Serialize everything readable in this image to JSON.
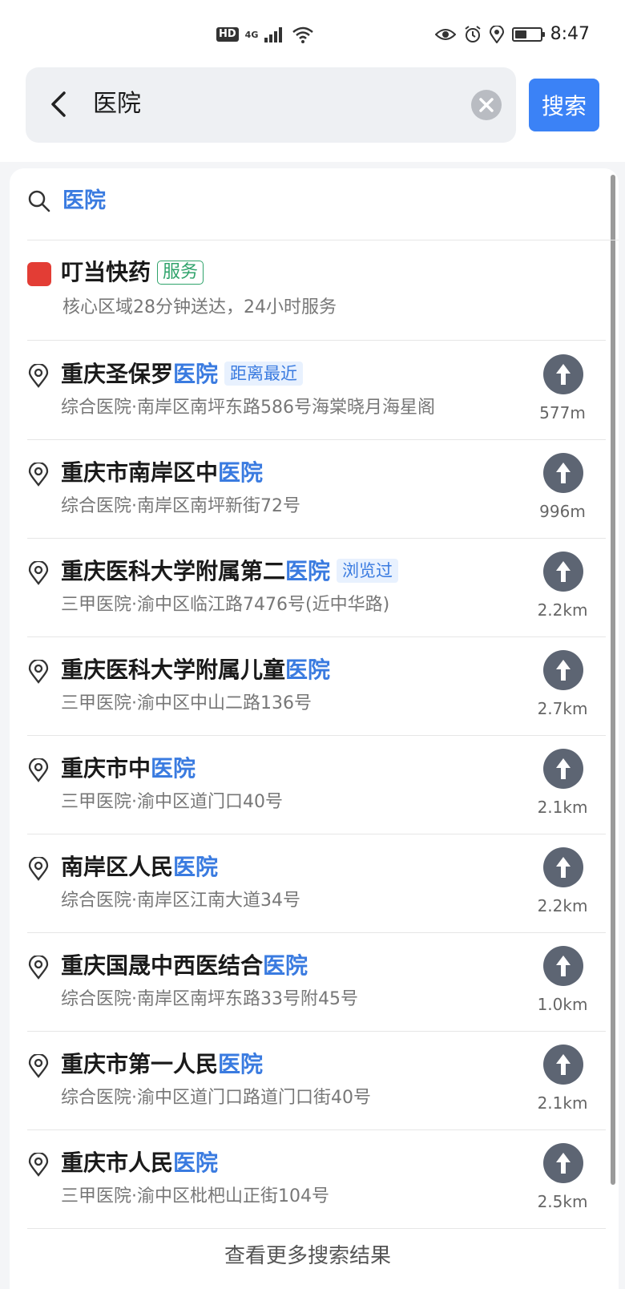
{
  "status_bar": {
    "hd": "HD",
    "net": "4G",
    "time": "8:47",
    "battery_level": 0.45
  },
  "search": {
    "query": "医院",
    "button_label": "搜索"
  },
  "suggestion": {
    "text": "医院"
  },
  "promo": {
    "logo_text": "叮当快药",
    "title": "叮当快药",
    "tag": "服务",
    "description": "核心区域28分钟送达，24小时服务"
  },
  "results": [
    {
      "name_prefix": "重庆圣保罗",
      "name_highlight": "医院",
      "badge": "距离最近",
      "address": "综合医院·南岸区南坪东路586号海棠晓月海星阁",
      "distance": "577m"
    },
    {
      "name_prefix": "重庆市南岸区中",
      "name_highlight": "医院",
      "badge": "",
      "address": "综合医院·南岸区南坪新街72号",
      "distance": "996m"
    },
    {
      "name_prefix": "重庆医科大学附属第二",
      "name_highlight": "医院",
      "badge": "浏览过",
      "address": "三甲医院·渝中区临江路7476号(近中华路)",
      "distance": "2.2km"
    },
    {
      "name_prefix": "重庆医科大学附属儿童",
      "name_highlight": "医院",
      "badge": "",
      "address": "三甲医院·渝中区中山二路136号",
      "distance": "2.7km"
    },
    {
      "name_prefix": "重庆市中",
      "name_highlight": "医院",
      "badge": "",
      "address": "三甲医院·渝中区道门口40号",
      "distance": "2.1km"
    },
    {
      "name_prefix": "南岸区人民",
      "name_highlight": "医院",
      "badge": "",
      "address": "综合医院·南岸区江南大道34号",
      "distance": "2.2km"
    },
    {
      "name_prefix": "重庆国晟中西医结合",
      "name_highlight": "医院",
      "badge": "",
      "address": "综合医院·南岸区南坪东路33号附45号",
      "distance": "1.0km"
    },
    {
      "name_prefix": "重庆市第一人民",
      "name_highlight": "医院",
      "badge": "",
      "address": "综合医院·渝中区道门口路道门口街40号",
      "distance": "2.1km"
    },
    {
      "name_prefix": "重庆市人民",
      "name_highlight": "医院",
      "badge": "",
      "address": "三甲医院·渝中区枇杷山正街104号",
      "distance": "2.5km"
    }
  ],
  "more_results": "查看更多搜索结果",
  "colors": {
    "accent": "#3b82f6",
    "highlight": "#3a7be0",
    "service_tag": "#2fa36b",
    "nav_button": "#5d6573"
  },
  "icons": {
    "back": "chevron-left-icon",
    "clear": "close-circle-icon",
    "suggest": "search-icon",
    "pin": "location-pin-icon",
    "nav": "navigate-arrow-icon"
  }
}
